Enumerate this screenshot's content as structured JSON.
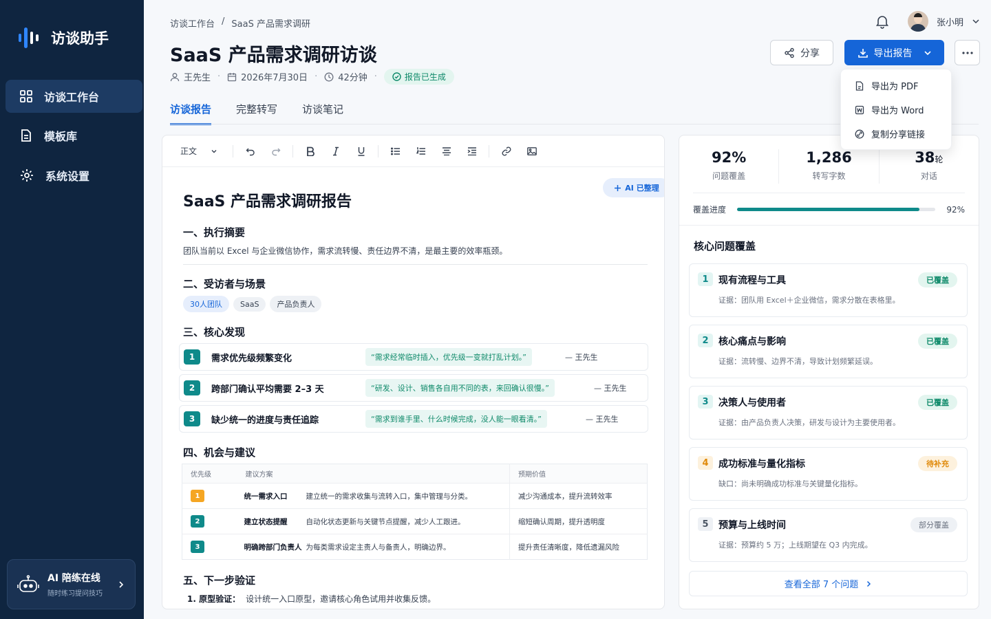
{
  "app": {
    "name": "访谈助手"
  },
  "sidebar": {
    "items": [
      {
        "label": "访谈工作台"
      },
      {
        "label": "模板库"
      },
      {
        "label": "系统设置"
      }
    ],
    "ai_card": {
      "title": "AI 陪练在线",
      "subtitle": "随时练习提问技巧"
    }
  },
  "header": {
    "breadcrumb": [
      "访谈工作台",
      "/",
      "SaaS 产品需求调研"
    ],
    "title": "SaaS 产品需求调研访谈",
    "meta": {
      "person": "王先生",
      "date": "2026年7月30日",
      "duration": "42分钟",
      "status": "报告已生成"
    },
    "user": {
      "name": "张小明"
    },
    "share_label": "分享",
    "export_label": "导出报告"
  },
  "export_menu": [
    {
      "label": "导出为 PDF"
    },
    {
      "label": "导出为 Word"
    },
    {
      "label": "复制分享链接"
    }
  ],
  "tabs": [
    {
      "label": "访谈报告"
    },
    {
      "label": "完整转写"
    },
    {
      "label": "访谈笔记"
    }
  ],
  "toolbar": {
    "style_select": "正文"
  },
  "doc": {
    "title": "SaaS 产品需求调研报告",
    "ai_tag": "AI 已整理",
    "s1": {
      "heading": "一、执行摘要",
      "text": "团队当前以 Excel 与企业微信协作，需求流转慢、责任边界不清，是最主要的效率瓶颈。"
    },
    "s2": {
      "heading": "二、受访者与场景",
      "chips": [
        "30人团队",
        "SaaS",
        "产品负责人"
      ]
    },
    "s3": {
      "heading": "三、核心发现",
      "findings": [
        {
          "num": "1",
          "title": "需求优先级频繁变化",
          "quote": "“需求经常临时插入，优先级一变就打乱计划。”",
          "who": "— 王先生"
        },
        {
          "num": "2",
          "title": "跨部门确认平均需要 2–3 天",
          "quote": "“研发、设计、销售各自用不同的表，来回确认很慢。”",
          "who": "— 王先生"
        },
        {
          "num": "3",
          "title": "缺少统一的进度与责任追踪",
          "quote": "“需求到谁手里、什么时候完成，没人能一眼看清。”",
          "who": "— 王先生"
        }
      ]
    },
    "s4": {
      "heading": "四、机会与建议",
      "columns": [
        "优先级",
        "建议方案",
        "预期价值"
      ],
      "rows": [
        {
          "p": "1",
          "name": "统一需求入口",
          "desc": "建立统一的需求收集与流转入口，集中管理与分类。",
          "value": "减少沟通成本，提升流转效率",
          "color": "#f5a623"
        },
        {
          "p": "2",
          "name": "建立状态提醒",
          "desc": "自动化状态更新与关键节点提醒，减少人工跟进。",
          "value": "缩短确认周期，提升透明度",
          "color": "#0f8a8a"
        },
        {
          "p": "3",
          "name": "明确跨部门负责人",
          "desc": "为每类需求设定主责人与备责人，明确边界。",
          "value": "提升责任清晰度，降低遗漏风险",
          "color": "#0f8a8a"
        }
      ]
    },
    "s5": {
      "heading": "五、下一步验证",
      "item_label": "1. 原型验证：",
      "item_text": "设计统一入口原型，邀请核心角色试用并收集反馈。"
    }
  },
  "panel": {
    "stats": [
      {
        "value": "92%",
        "unit": "",
        "label": "问题覆盖"
      },
      {
        "value": "1,286",
        "unit": "",
        "label": "转写字数"
      },
      {
        "value": "38",
        "unit": "轮",
        "label": "对话"
      }
    ],
    "progress": {
      "label": "覆盖进度",
      "value_text": "92%",
      "value": 0.92
    },
    "title": "核心问题覆盖",
    "questions": [
      {
        "num": "1",
        "title": "现有流程与工具",
        "status": "已覆盖",
        "desc": "证据：团队用 Excel＋企业微信，需求分散在表格里。",
        "kind": "done"
      },
      {
        "num": "2",
        "title": "核心痛点与影响",
        "status": "已覆盖",
        "desc": "证据：流转慢、边界不清，导致计划频繁延误。",
        "kind": "done"
      },
      {
        "num": "3",
        "title": "决策人与使用者",
        "status": "已覆盖",
        "desc": "证据：由产品负责人决策，研发与设计为主要使用者。",
        "kind": "done"
      },
      {
        "num": "4",
        "title": "成功标准与量化指标",
        "status": "待补充",
        "desc": "缺口：尚未明确成功标准与关键量化指标。",
        "kind": "todo"
      },
      {
        "num": "5",
        "title": "预算与上线时间",
        "status": "部分覆盖",
        "desc": "证据：预算约 5 万；上线期望在 Q3 内完成。",
        "kind": "partial"
      }
    ],
    "view_all": "查看全部 7 个问题"
  },
  "colors": {
    "primary": "#1565d8",
    "teal": "#0f8a8a",
    "sidebar": "#0f2540",
    "orange": "#f5a623"
  }
}
